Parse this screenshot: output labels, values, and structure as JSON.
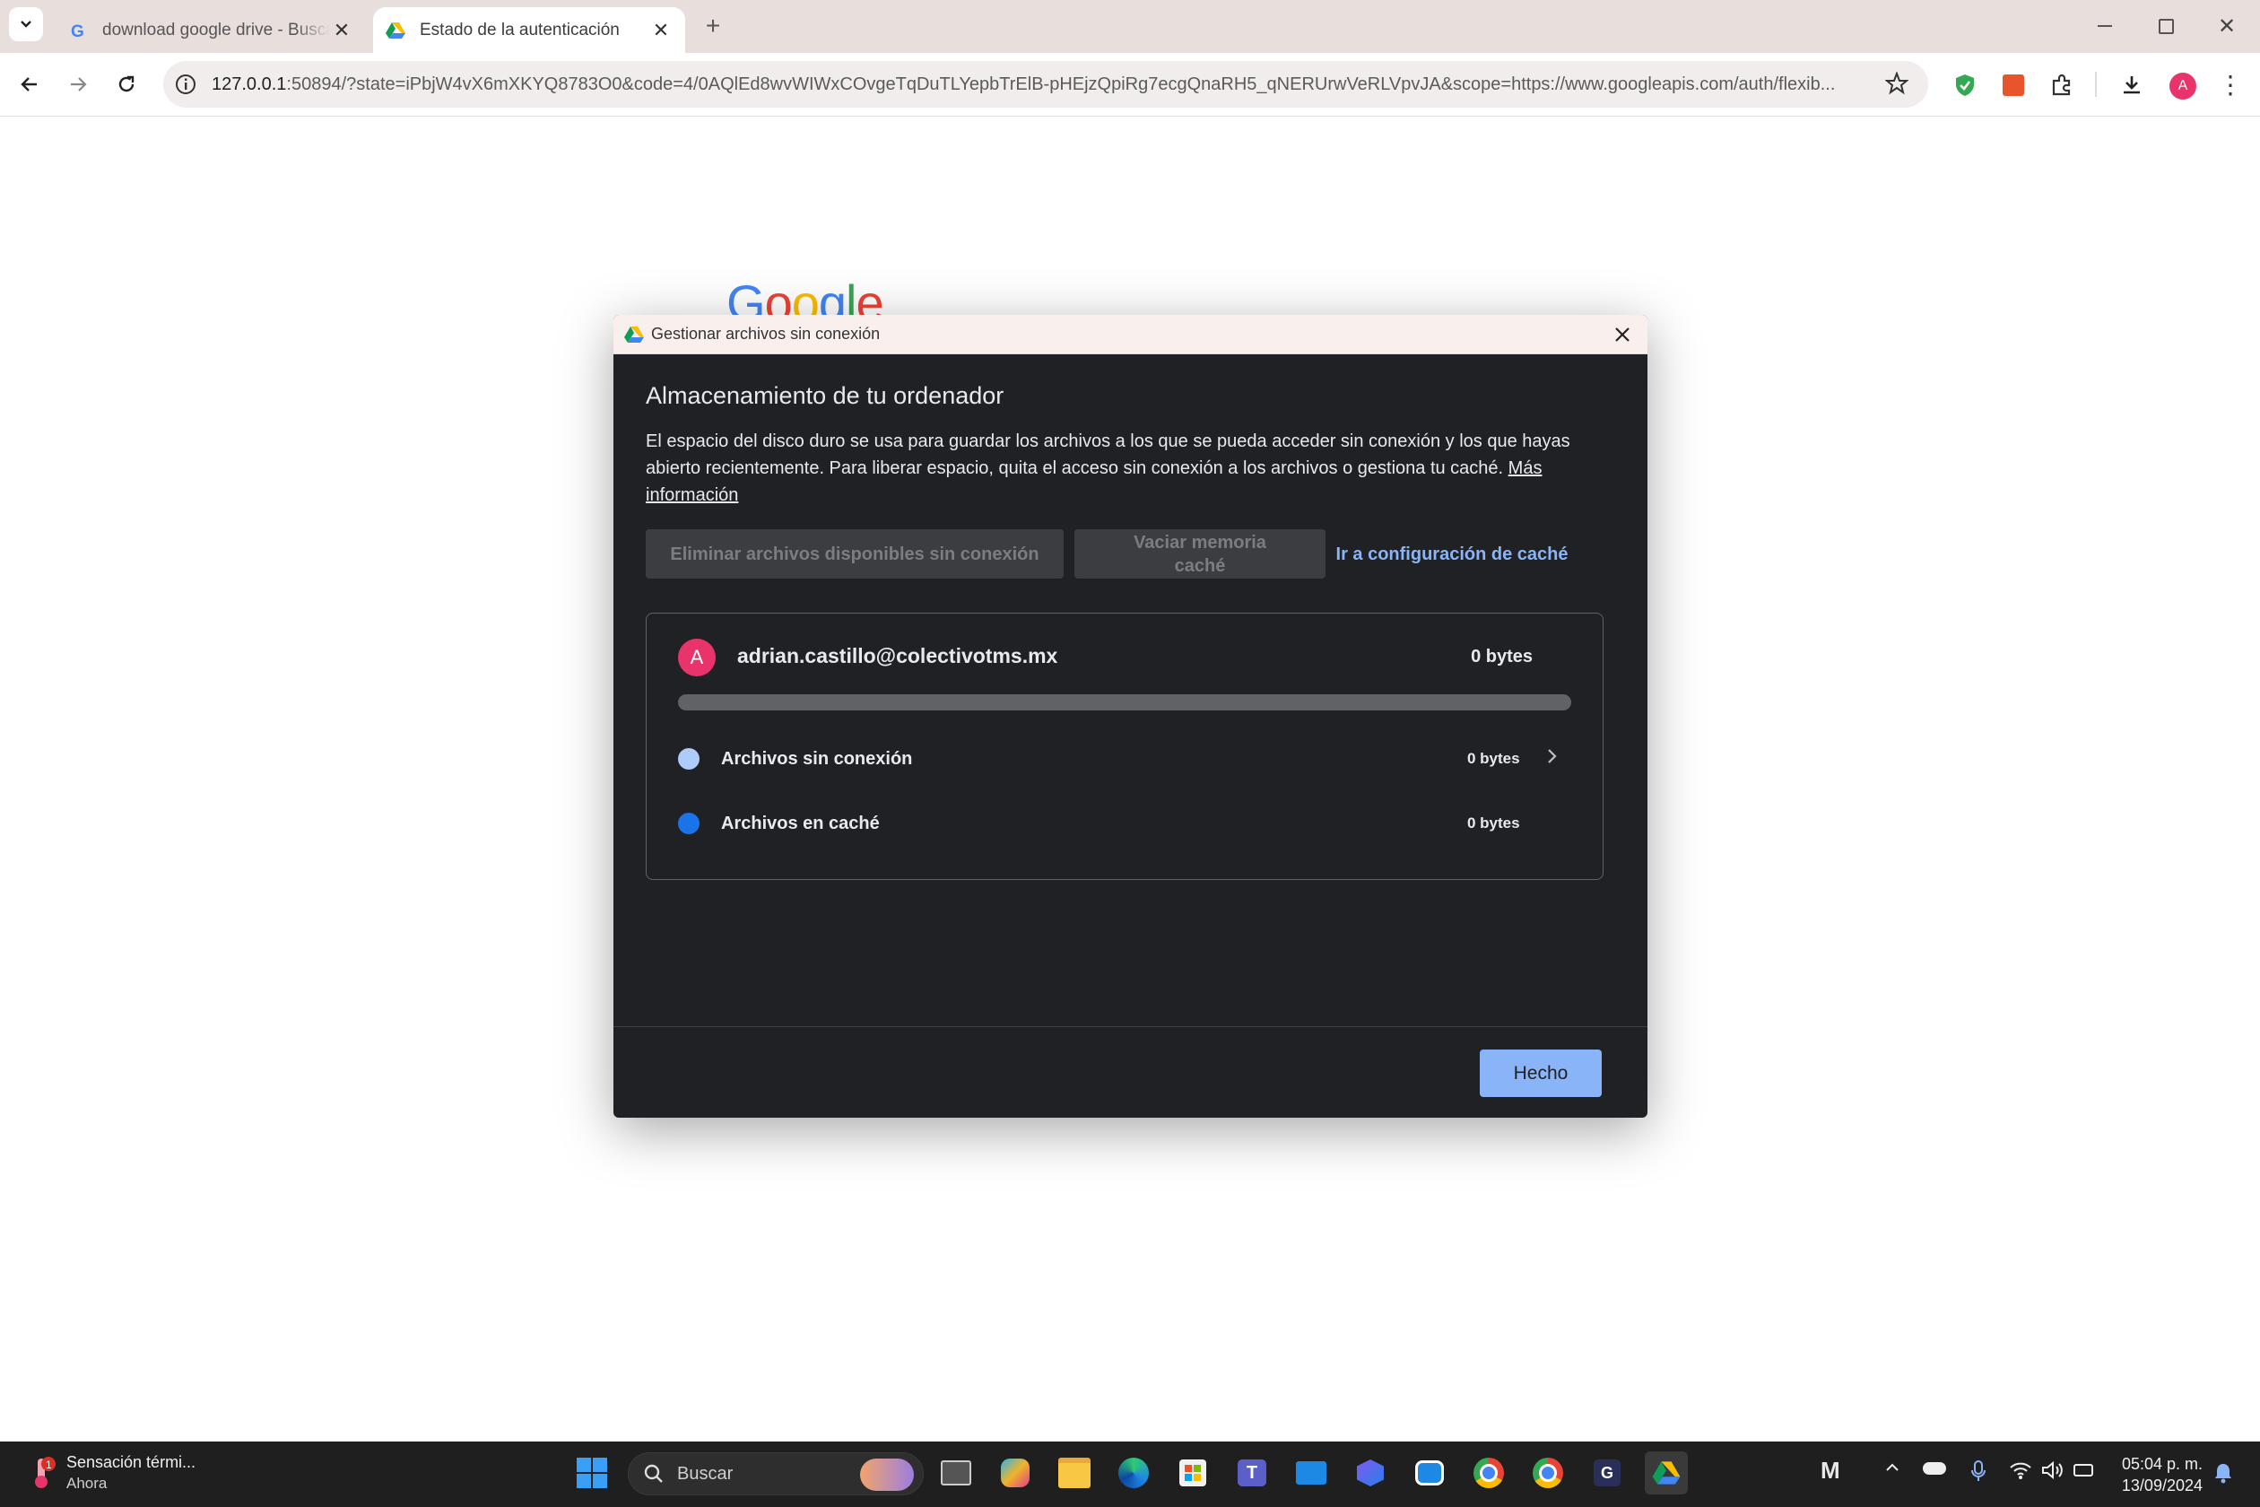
{
  "browser": {
    "tabs": [
      {
        "title": "download google drive - Buscar",
        "icon": "google-g-icon",
        "active": false
      },
      {
        "title": "Estado de la autenticación",
        "icon": "google-drive-icon",
        "active": true
      }
    ],
    "address": {
      "host": "127.0.0.1",
      "rest": ":50894/?state=iPbjW4vX6mXKYQ8783O0&code=4/0AQlEd8wvWIWxCOvgeTqDuTLYepbTrElB-pHEjzQpiRg7ecgQnaRH5_qNERUrwVeRLVpvJA&scope=https://www.googleapis.com/auth/flexib..."
    },
    "profile_initial": "A"
  },
  "page": {
    "logo_text": "Google"
  },
  "dialog": {
    "window_title": "Gestionar archivos sin conexión",
    "heading": "Almacenamiento de tu ordenador",
    "description": "El espacio del disco duro se usa para guardar los archivos a los que se pueda acceder sin conexión y los que hayas abierto recientemente. Para liberar espacio, quita el acceso sin conexión a los archivos o gestiona tu caché. ",
    "learn_more": "Más información",
    "buttons": {
      "remove_offline": "Eliminar archivos disponibles sin conexión",
      "clear_cache": "Vaciar memoria caché",
      "cache_settings": "Ir a configuración de caché"
    },
    "account": {
      "initial": "A",
      "email": "adrian.castillo@colectivotms.mx",
      "total": "0 bytes",
      "usage_fraction": 0,
      "rows": [
        {
          "label": "Archivos sin conexión",
          "value": "0 bytes",
          "color": "#aecbfa"
        },
        {
          "label": "Archivos en caché",
          "value": "0 bytes",
          "color": "#1a73e8"
        }
      ]
    },
    "done": "Hecho"
  },
  "taskbar": {
    "weather_title": "Sensación térmi...",
    "weather_sub": "Ahora",
    "search_placeholder": "Buscar",
    "time": "05:04 p. m.",
    "date": "13/09/2024"
  }
}
